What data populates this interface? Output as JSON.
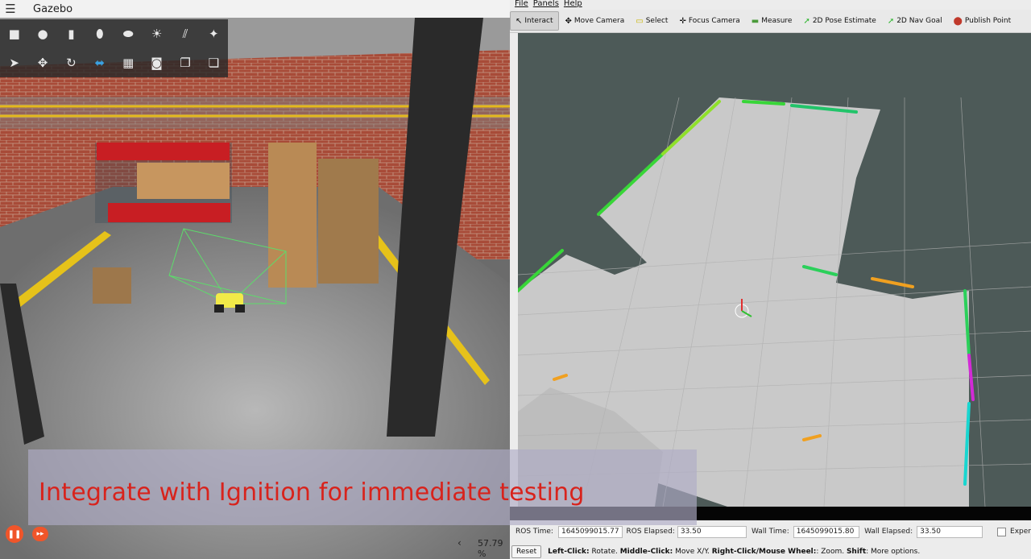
{
  "gazebo": {
    "title": "Gazebo",
    "toolbar_row1": [
      "cube-icon",
      "sphere-icon",
      "cylinder-icon",
      "capsule-icon",
      "ellipsoid-icon",
      "sun-icon",
      "directional-light-icon",
      "spot-light-icon"
    ],
    "toolbar_row2": [
      "select-icon",
      "translate-icon",
      "rotate-icon",
      "scale-icon",
      "grid-icon",
      "camera-icon",
      "copy-icon",
      "paste-icon"
    ],
    "rtf": "57.79 %",
    "chevron": "‹"
  },
  "rviz": {
    "menu": [
      "File",
      "Panels",
      "Help"
    ],
    "tools": [
      {
        "label": "Interact",
        "icon": "cursor-icon",
        "active": true
      },
      {
        "label": "Move Camera",
        "icon": "move-camera-icon",
        "active": false
      },
      {
        "label": "Select",
        "icon": "select-box-icon",
        "active": false
      },
      {
        "label": "Focus Camera",
        "icon": "focus-icon",
        "active": false
      },
      {
        "label": "Measure",
        "icon": "ruler-icon",
        "active": false
      },
      {
        "label": "2D Pose Estimate",
        "icon": "pose-arrow-icon",
        "active": false
      },
      {
        "label": "2D Nav Goal",
        "icon": "nav-arrow-icon",
        "active": false
      },
      {
        "label": "Publish Point",
        "icon": "map-pin-icon",
        "active": false
      }
    ],
    "time": {
      "ros_time_label": "ROS Time:",
      "ros_time": "1645099015.77",
      "ros_elapsed_label": "ROS Elapsed:",
      "ros_elapsed": "33.50",
      "wall_time_label": "Wall Time:",
      "wall_time": "1645099015.80",
      "wall_elapsed_label": "Wall Elapsed:",
      "wall_elapsed": "33.50",
      "experimental": "Exper"
    },
    "status": {
      "reset": "Reset",
      "left_click": "Left-Click:",
      "left_click_desc": " Rotate. ",
      "middle_click": "Middle-Click:",
      "middle_click_desc": " Move X/Y. ",
      "right_click": "Right-Click/Mouse Wheel:",
      "right_click_desc": ": Zoom. ",
      "shift": "Shift",
      "shift_desc": ": More options."
    }
  },
  "caption": "Integrate with Ignition for immediate testing",
  "colors": {
    "accent_orange": "#f0552a",
    "caption_red": "#d8231c",
    "rviz_bg": "#4d5a58",
    "map_floor": "#c9c9c9"
  }
}
